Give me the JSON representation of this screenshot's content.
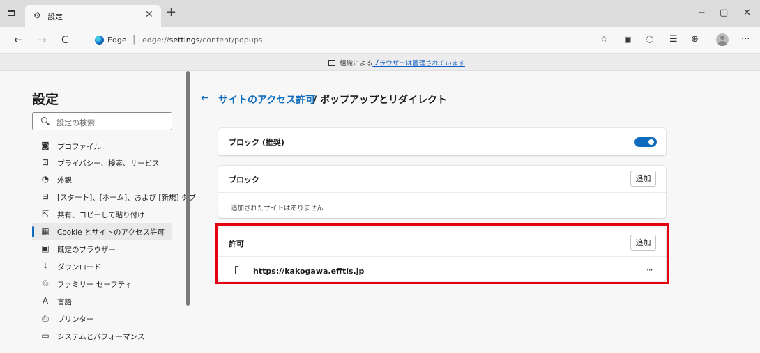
{
  "window": {
    "tab_title": "設定",
    "tab_icon": "gear-icon",
    "controls": {
      "minimize": "−",
      "maximize": "▢",
      "close": "✕"
    }
  },
  "toolbar": {
    "back": "←",
    "forward": "→",
    "refresh": "C",
    "edge_label": "Edge",
    "url_prefix": "edge://",
    "url_highlight": "settings",
    "url_suffix": "/content/popups"
  },
  "managed_bar": {
    "prefix": "組織による",
    "link": "ブラウザーは管理されています"
  },
  "sidebar": {
    "title": "設定",
    "search_placeholder": "設定の検索",
    "items": [
      {
        "icon": "profile-icon",
        "glyph": "◙",
        "label": "プロファイル"
      },
      {
        "icon": "lock-icon",
        "glyph": "⊡",
        "label": "プライバシー、検索、サービス"
      },
      {
        "icon": "appearance-icon",
        "glyph": "◔",
        "label": "外観"
      },
      {
        "icon": "start-page-icon",
        "glyph": "⊟",
        "label": "[スタート]、[ホーム]、および [新規] タブ"
      },
      {
        "icon": "share-icon",
        "glyph": "⇱",
        "label": "共有、コピーして貼り付け"
      },
      {
        "icon": "cookie-icon",
        "glyph": "▦",
        "label": "Cookie とサイトのアクセス許可",
        "active": true
      },
      {
        "icon": "default-browser-icon",
        "glyph": "▣",
        "label": "既定のブラウザー"
      },
      {
        "icon": "download-icon",
        "glyph": "⤓",
        "label": "ダウンロード"
      },
      {
        "icon": "family-icon",
        "glyph": "♲",
        "label": "ファミリー セーフティ"
      },
      {
        "icon": "language-icon",
        "glyph": "A",
        "label": "言語"
      },
      {
        "icon": "printer-icon",
        "glyph": "⎙",
        "label": "プリンター"
      },
      {
        "icon": "system-icon",
        "glyph": "▭",
        "label": "システムとパフォーマンス"
      }
    ]
  },
  "main": {
    "back_arrow": "←",
    "breadcrumb_parent": "サイトのアクセス許可",
    "breadcrumb_current": "/ ポップアップとリダイレクト",
    "block_recommended": {
      "label": "ブロック (推奨)",
      "enabled": true
    },
    "block_section": {
      "title": "ブロック",
      "add_label": "追加",
      "empty_text": "追加されたサイトはありません"
    },
    "allow_section": {
      "title": "許可",
      "add_label": "追加",
      "sites": [
        {
          "url": "https://kakogawa.efftis.jp",
          "more": "···"
        }
      ]
    }
  },
  "colors": {
    "accent": "#0f6cbd",
    "highlight": "#e60012"
  }
}
